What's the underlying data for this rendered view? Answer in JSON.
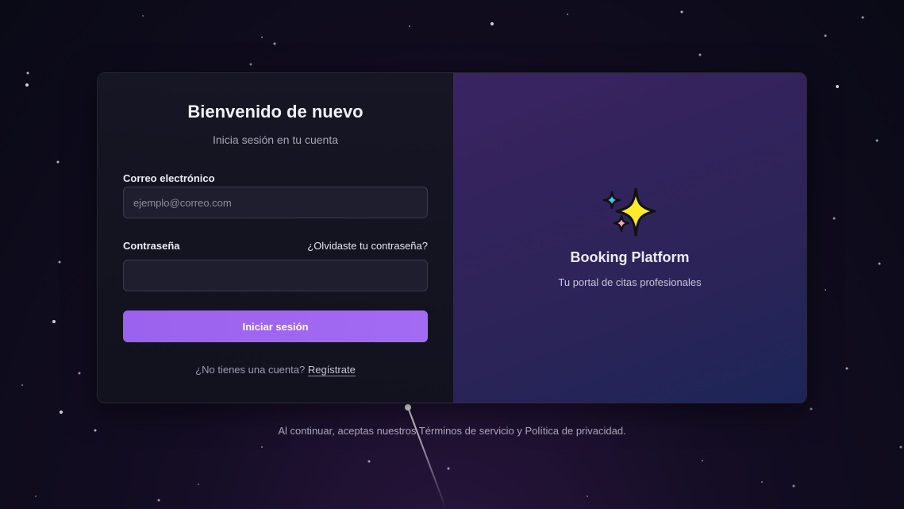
{
  "login": {
    "title": "Bienvenido de nuevo",
    "subtitle": "Inicia sesión en tu cuenta",
    "email_label": "Correo electrónico",
    "email_placeholder": "ejemplo@correo.com",
    "email_value": "",
    "password_label": "Contraseña",
    "password_value": "",
    "forgot_link": "¿Olvidaste tu contraseña?",
    "submit_label": "Iniciar sesión",
    "signup_prompt": "¿No tienes una cuenta?",
    "signup_link": "Regístrate"
  },
  "brand": {
    "icon": "sparkles-icon",
    "name": "Booking Platform",
    "tagline": "Tu portal de citas profesionales"
  },
  "footer": {
    "text": "Al continuar, aceptas nuestros Términos de servicio y Política de privacidad."
  },
  "colors": {
    "accent": "#9a62ee",
    "card_left_bg": "#161624",
    "card_right_bg": "#33235c",
    "background": "#0a0a16"
  }
}
